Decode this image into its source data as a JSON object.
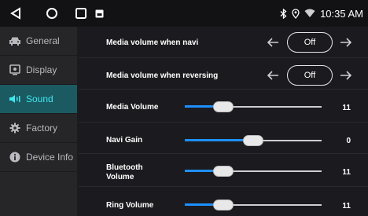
{
  "status": {
    "time": "10:35 AM",
    "icons": [
      "back-icon",
      "home-icon",
      "recents-icon",
      "notification-icon",
      "bluetooth-icon",
      "location-icon",
      "wifi-icon"
    ]
  },
  "sidebar": {
    "items": [
      {
        "label": "General",
        "icon": "car-icon",
        "active": false
      },
      {
        "label": "Display",
        "icon": "display-icon",
        "active": false
      },
      {
        "label": "Sound",
        "icon": "speaker-icon",
        "active": true
      },
      {
        "label": "Factory",
        "icon": "gear-icon",
        "active": false
      },
      {
        "label": "Device Info",
        "icon": "info-icon",
        "active": false
      }
    ]
  },
  "settings": {
    "navi_media": {
      "label": "Media volume when navi",
      "value": "Off"
    },
    "reverse_media": {
      "label": "Media volume when reversing",
      "value": "Off"
    },
    "media_volume": {
      "label": "Media Volume",
      "value": "11",
      "level": 0.28
    },
    "navi_gain": {
      "label": "Navi Gain",
      "value": "0",
      "level": 0.5
    },
    "bluetooth_volume": {
      "label": "Bluetooth\nVolume",
      "value": "11",
      "level": 0.28
    },
    "ring_volume": {
      "label": "Ring Volume",
      "value": "11",
      "level": 0.28
    }
  },
  "colors": {
    "accent": "#3ee8ef",
    "active_bg": "#1c5a62",
    "slider_fill": "#1e8fff"
  }
}
